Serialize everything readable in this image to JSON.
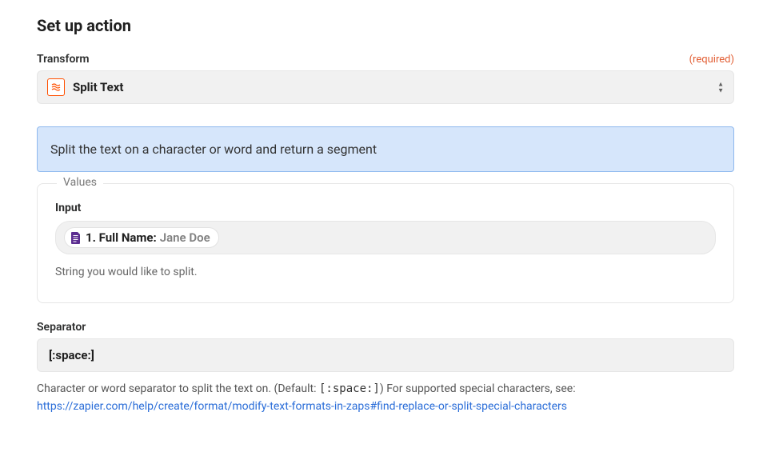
{
  "title": "Set up action",
  "transform": {
    "label": "Transform",
    "required_label": "(required)",
    "selected": "Split Text"
  },
  "banner": "Split the text on a character or word and return a segment",
  "values": {
    "legend": "Values",
    "input": {
      "label": "Input",
      "chip_key": "1. Full Name:",
      "chip_val": "Jane Doe",
      "help": "String you would like to split."
    }
  },
  "separator": {
    "label": "Separator",
    "value": "[:space:]",
    "help_prefix": "Character or word separator to split the text on. (Default: ",
    "help_default": "[:space:]",
    "help_suffix": ") For supported special characters, see:",
    "link": "https://zapier.com/help/create/format/modify-text-formats-in-zaps#find-replace-or-split-special-characters"
  }
}
